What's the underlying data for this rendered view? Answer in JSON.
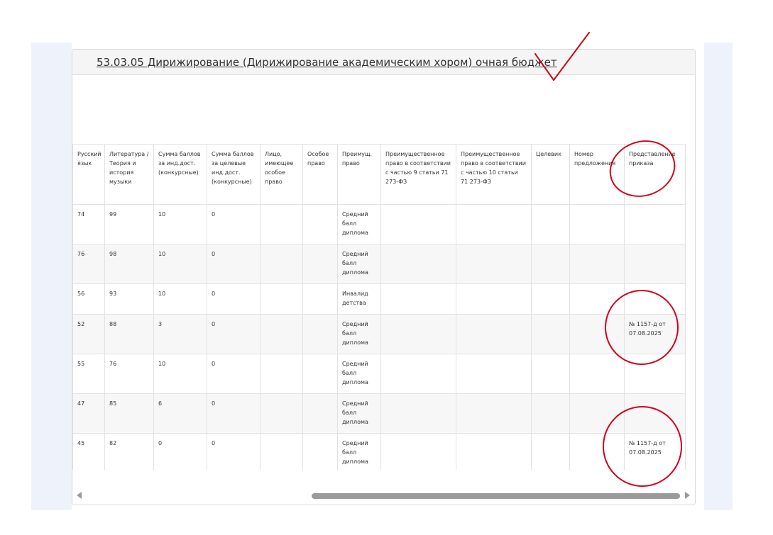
{
  "title": "53.03.05 Дирижирование (Дирижирование академическим хором) очная бюджет",
  "headers": [
    "Русский язык",
    "Литература / Теория и история музыки",
    "Сумма баллов за инд.дост. (конкурсные)",
    "Сумма баллов за целевые инд.дост. (конкурсные)",
    "Лицо, имеющее особое право",
    "Особое право",
    "Преимущ. право",
    "Преимущественное право в соответствии с частью 9 статьи 71 273-ФЗ",
    "Преимущественное право в соответствии с частью 10 статьи 71 273-ФЗ",
    "Целевик",
    "Номер предложения",
    "Представление приказа"
  ],
  "rows": [
    [
      "74",
      "99",
      "10",
      "0",
      "",
      "",
      "Средний балл диплома",
      "",
      "",
      "",
      "",
      ""
    ],
    [
      "76",
      "98",
      "10",
      "0",
      "",
      "",
      "Средний балл диплома",
      "",
      "",
      "",
      "",
      ""
    ],
    [
      "56",
      "93",
      "10",
      "0",
      "",
      "",
      "Инвалид детства",
      "",
      "",
      "",
      "",
      ""
    ],
    [
      "52",
      "88",
      "3",
      "0",
      "",
      "",
      "Средний балл диплома",
      "",
      "",
      "",
      "",
      "№ 1157-д от 07.08.2025"
    ],
    [
      "55",
      "76",
      "10",
      "0",
      "",
      "",
      "Средний балл диплома",
      "",
      "",
      "",
      "",
      ""
    ],
    [
      "47",
      "85",
      "6",
      "0",
      "",
      "",
      "Средний балл диплома",
      "",
      "",
      "",
      "",
      ""
    ],
    [
      "45",
      "82",
      "0",
      "0",
      "",
      "",
      "Средний балл диплома",
      "",
      "",
      "",
      "",
      "№ 1157-д от 07.08.2025"
    ]
  ],
  "colors": {
    "annotation": "#d0021b",
    "scrollbar": "#9a9a9a"
  }
}
